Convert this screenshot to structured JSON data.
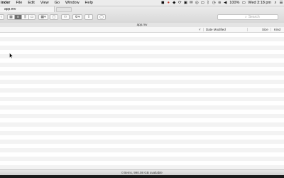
{
  "menubar": {
    "app": "inder",
    "items": [
      "File",
      "Edit",
      "View",
      "Go",
      "Window",
      "Help"
    ],
    "battery": "100%",
    "clock": "Wed 3:18 pm"
  },
  "tabs": [
    {
      "label": "app.mv"
    }
  ],
  "search": {
    "placeholder": "Search"
  },
  "path": {
    "title": "app.mv"
  },
  "columns": {
    "name": "",
    "date_modified": "Date Modified",
    "size": "Size",
    "kind": "Kind"
  },
  "status": {
    "text": "0 items, 990.08 GB available"
  }
}
